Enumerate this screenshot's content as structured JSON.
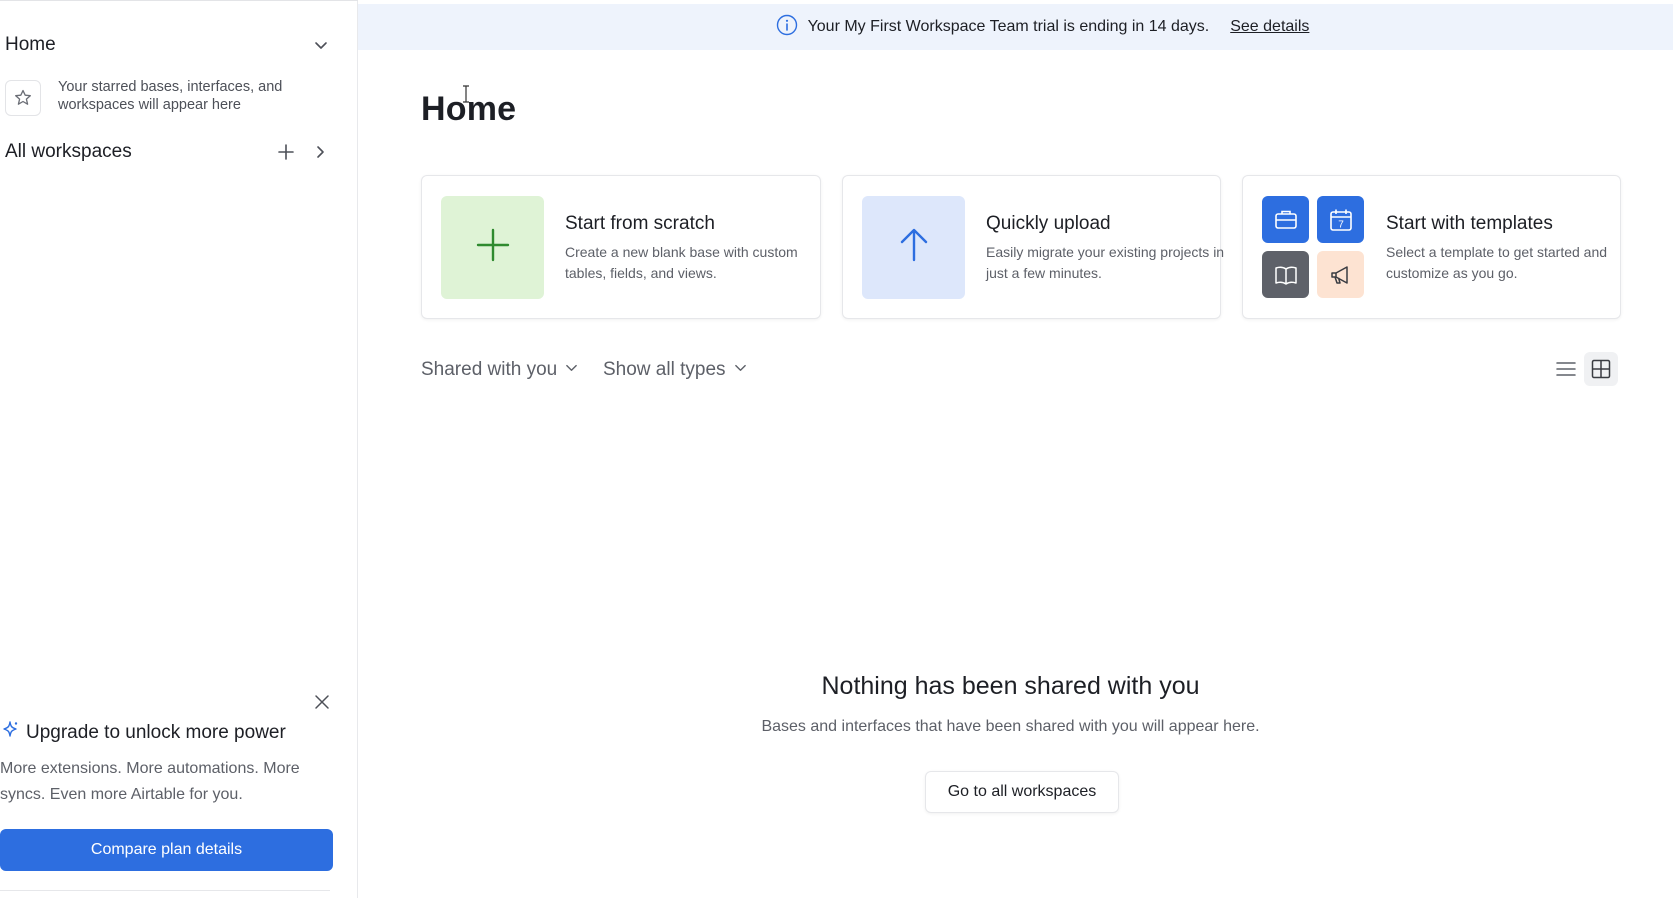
{
  "sidebar": {
    "home_label": "Home",
    "starred_text": "Your starred bases, interfaces, and workspaces will appear here",
    "all_workspaces_label": "All workspaces",
    "upgrade": {
      "title": "Upgrade to unlock more power",
      "description": "More extensions. More automations. More syncs. Even more Airtable for you.",
      "button_label": "Compare plan details"
    }
  },
  "banner": {
    "text": "Your My First Workspace Team trial is ending in 14 days.",
    "link_label": "See details"
  },
  "main": {
    "title": "Home",
    "cards": [
      {
        "title": "Start from scratch",
        "description": "Create a new blank base with custom tables, fields, and views."
      },
      {
        "title": "Quickly upload",
        "description": "Easily migrate your existing projects in just a few minutes."
      },
      {
        "title": "Start with templates",
        "description": "Select a template to get started and customize as you go."
      }
    ],
    "filters": {
      "shared": "Shared with you",
      "types": "Show all types"
    },
    "empty_state": {
      "title": "Nothing has been shared with you",
      "description": "Bases and interfaces that have been shared with you will appear here.",
      "button_label": "Go to all workspaces"
    },
    "calendar_day": "7"
  },
  "colors": {
    "accent": "#2d6ee0",
    "banner_bg": "#eef3fc",
    "scratch_tile": "#dff3d6",
    "upload_tile": "#dde7fb",
    "template_blue": "#2d6ee0",
    "template_gray": "#5e6169",
    "template_peach": "#fde3d2"
  }
}
